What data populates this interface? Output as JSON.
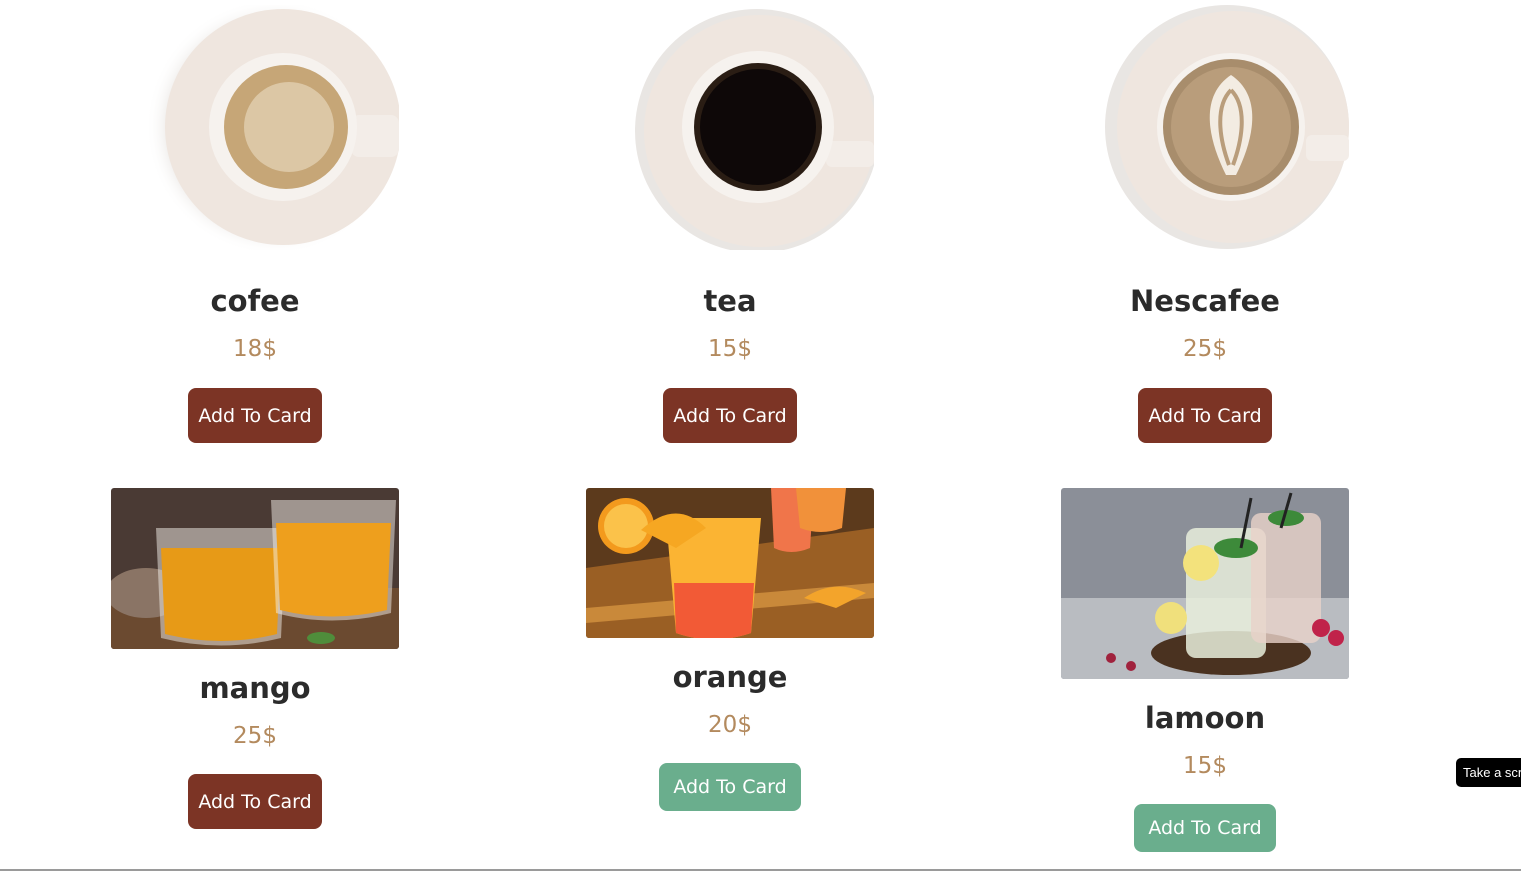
{
  "products": [
    {
      "name": "cofee",
      "price": "18$",
      "button": "Add To Card",
      "image": "coffee-cup-image"
    },
    {
      "name": "tea",
      "price": "15$",
      "button": "Add To Card",
      "image": "black-coffee-cup-image"
    },
    {
      "name": "Nescafee",
      "price": "25$",
      "button": "Add To Card",
      "image": "latte-art-cup-image"
    },
    {
      "name": "mango",
      "price": "25$",
      "button": "Add To Card",
      "image": "mango-juice-glasses-image"
    },
    {
      "name": "orange",
      "price": "20$",
      "button": "Add To Card",
      "image": "orange-cocktail-image"
    },
    {
      "name": "lamoon",
      "price": "15$",
      "button": "Add To Card",
      "image": "lemonade-jars-image"
    }
  ],
  "colors": {
    "brown_button": "#7c3425",
    "green_button": "#6aae8d",
    "price": "#b38a5e",
    "title": "#2b2b2b"
  },
  "tooltip": {
    "text": "Take a screenshot"
  }
}
